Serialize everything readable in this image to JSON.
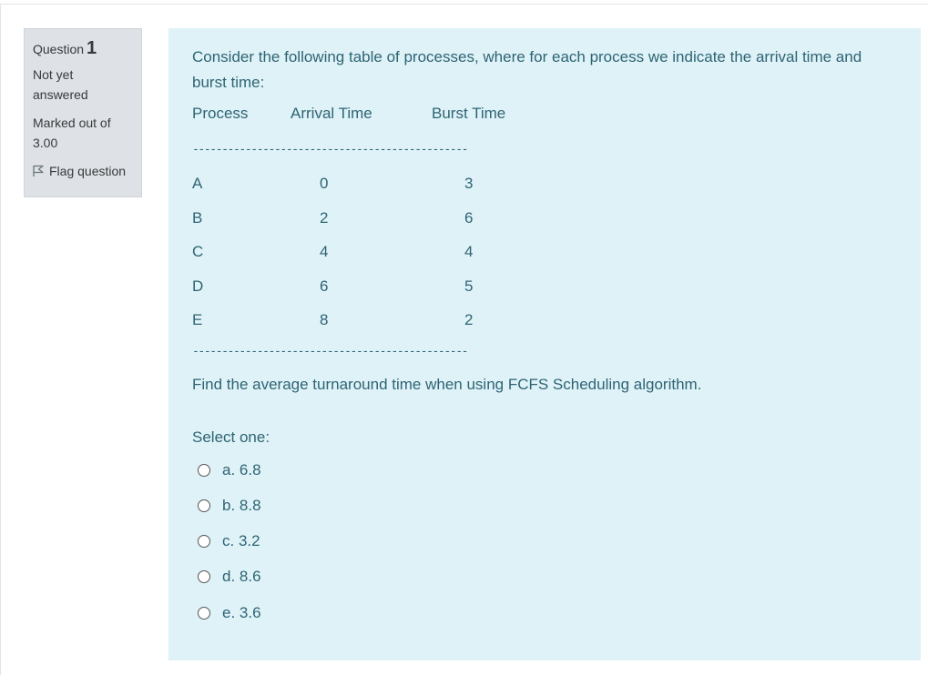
{
  "info": {
    "question_label": "Question",
    "question_number": "1",
    "state_line1": "Not yet",
    "state_line2": "answered",
    "grade_line1": "Marked out of",
    "grade_line2": "3.00",
    "flag_label": "Flag question",
    "flag_icon": "flag-icon"
  },
  "question": {
    "text": "Consider the following table of processes, where for each process we indicate the arrival time and burst time:",
    "table": {
      "headers": [
        "Process",
        "Arrival Time",
        "Burst Time"
      ],
      "separator_top": "-----------------------------------------------",
      "separator_bottom": "-----------------------------------------------",
      "rows": [
        {
          "process": "A",
          "arrival": "0",
          "burst": "3"
        },
        {
          "process": "B",
          "arrival": "2",
          "burst": "6"
        },
        {
          "process": "C",
          "arrival": "4",
          "burst": "4"
        },
        {
          "process": "D",
          "arrival": "6",
          "burst": "5"
        },
        {
          "process": "E",
          "arrival": "8",
          "burst": "2"
        }
      ]
    },
    "prompt": "Find the average turnaround time when using FCFS Scheduling algorithm.",
    "select_label": "Select one:",
    "options": [
      {
        "letter": "a.",
        "value": "6.8"
      },
      {
        "letter": "b.",
        "value": "8.8"
      },
      {
        "letter": "c.",
        "value": "3.2"
      },
      {
        "letter": "d.",
        "value": "8.6"
      },
      {
        "letter": "e.",
        "value": "3.6"
      }
    ]
  },
  "colors": {
    "content_bg": "#def2f8",
    "content_text": "#2f6473",
    "info_bg": "#dee2e6"
  }
}
